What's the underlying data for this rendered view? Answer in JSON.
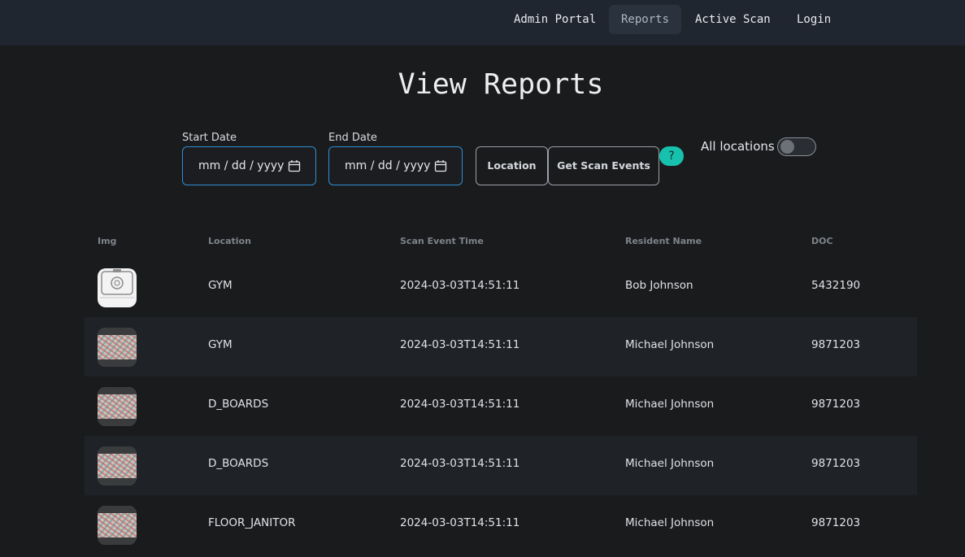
{
  "nav": {
    "items": [
      {
        "label": "Admin Portal",
        "active": false
      },
      {
        "label": "Reports",
        "active": true
      },
      {
        "label": "Active Scan",
        "active": false
      },
      {
        "label": "Login",
        "active": false
      }
    ]
  },
  "page": {
    "title": "View Reports"
  },
  "filters": {
    "start_date": {
      "label": "Start Date",
      "placeholder": "mm / dd / yyyy"
    },
    "end_date": {
      "label": "End Date",
      "placeholder": "mm / dd / yyyy"
    },
    "location_button": "Location",
    "get_events_button": "Get Scan Events",
    "help_label": "?",
    "all_locations_label": "All locations",
    "all_locations_on": false
  },
  "table": {
    "columns": [
      "Img",
      "Location",
      "Scan Event Time",
      "Resident Name",
      "DOC"
    ],
    "rows": [
      {
        "img": "no-image",
        "location": "GYM",
        "time": "2024-03-03T14:51:11",
        "name": "Bob Johnson",
        "doc": "5432190"
      },
      {
        "img": "photo",
        "location": "GYM",
        "time": "2024-03-03T14:51:11",
        "name": "Michael Johnson",
        "doc": "9871203"
      },
      {
        "img": "photo",
        "location": "D_BOARDS",
        "time": "2024-03-03T14:51:11",
        "name": "Michael Johnson",
        "doc": "9871203"
      },
      {
        "img": "photo",
        "location": "D_BOARDS",
        "time": "2024-03-03T14:51:11",
        "name": "Michael Johnson",
        "doc": "9871203"
      },
      {
        "img": "photo",
        "location": "FLOOR_JANITOR",
        "time": "2024-03-03T14:51:11",
        "name": "Michael Johnson",
        "doc": "9871203"
      }
    ]
  },
  "colors": {
    "accent": "#17c1ad",
    "input_border": "#2f8fd6",
    "navbar": "#202630"
  }
}
